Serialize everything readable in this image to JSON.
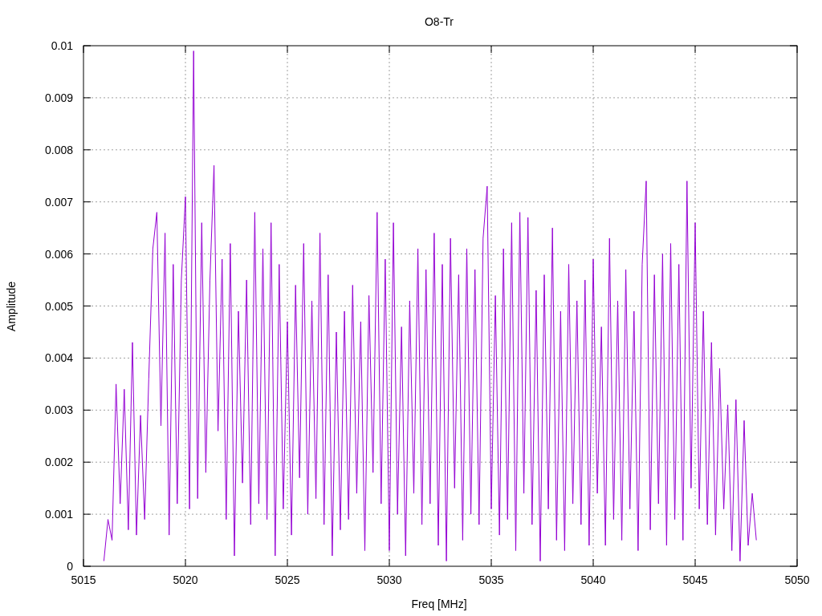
{
  "plot": {
    "chart_data": {
      "type": "line",
      "title": "O8-Tr",
      "xlabel": "Freq [MHz]",
      "ylabel": "Amplitude",
      "grid": true,
      "xlim": [
        5015,
        5050
      ],
      "ylim": [
        0,
        0.01
      ],
      "xticks": [
        5015,
        5020,
        5025,
        5030,
        5035,
        5040,
        5045,
        5050
      ],
      "yticks": [
        0.01,
        0.009,
        0.008,
        0.007,
        0.006,
        0.005,
        0.004,
        0.003,
        0.002,
        0.001,
        0
      ],
      "x": [
        5016,
        5016.2,
        5016.4,
        5016.6,
        5016.8,
        5017,
        5017.2,
        5017.4,
        5017.6,
        5017.8,
        5018,
        5018.2,
        5018.4,
        5018.6,
        5018.8,
        5019,
        5019.2,
        5019.4,
        5019.6,
        5019.8,
        5020,
        5020.2,
        5020.4,
        5020.6,
        5020.8,
        5021,
        5021.2,
        5021.4,
        5021.6,
        5021.8,
        5022,
        5022.2,
        5022.4,
        5022.6,
        5022.8,
        5023,
        5023.2,
        5023.4,
        5023.6,
        5023.8,
        5024,
        5024.2,
        5024.4,
        5024.6,
        5024.8,
        5025,
        5025.2,
        5025.4,
        5025.6,
        5025.8,
        5026,
        5026.2,
        5026.4,
        5026.6,
        5026.8,
        5027,
        5027.2,
        5027.4,
        5027.6,
        5027.8,
        5028,
        5028.2,
        5028.4,
        5028.6,
        5028.8,
        5029,
        5029.2,
        5029.4,
        5029.6,
        5029.8,
        5030,
        5030.2,
        5030.4,
        5030.6,
        5030.8,
        5031,
        5031.2,
        5031.4,
        5031.6,
        5031.8,
        5032,
        5032.2,
        5032.4,
        5032.6,
        5032.8,
        5033,
        5033.2,
        5033.4,
        5033.6,
        5033.8,
        5034,
        5034.2,
        5034.4,
        5034.6,
        5034.8,
        5035,
        5035.2,
        5035.4,
        5035.6,
        5035.8,
        5036,
        5036.2,
        5036.4,
        5036.6,
        5036.8,
        5037,
        5037.2,
        5037.4,
        5037.6,
        5037.8,
        5038,
        5038.2,
        5038.4,
        5038.6,
        5038.8,
        5039,
        5039.2,
        5039.4,
        5039.6,
        5039.8,
        5040,
        5040.2,
        5040.4,
        5040.6,
        5040.8,
        5041,
        5041.2,
        5041.4,
        5041.6,
        5041.8,
        5042,
        5042.2,
        5042.4,
        5042.6,
        5042.8,
        5043,
        5043.2,
        5043.4,
        5043.6,
        5043.8,
        5044,
        5044.2,
        5044.4,
        5044.6,
        5044.8,
        5045,
        5045.2,
        5045.4,
        5045.6,
        5045.8,
        5046,
        5046.2,
        5046.4,
        5046.6,
        5046.8,
        5047,
        5047.2,
        5047.4,
        5047.6,
        5047.8,
        5048
      ],
      "series": [
        {
          "color": "#9400d3",
          "values": [
            0.0001,
            0.0009,
            0.0005,
            0.0035,
            0.0012,
            0.0034,
            0.0007,
            0.0043,
            0.0006,
            0.0029,
            0.0009,
            0.0036,
            0.0061,
            0.0068,
            0.0027,
            0.0064,
            0.0006,
            0.0058,
            0.0012,
            0.0055,
            0.0071,
            0.0011,
            0.0099,
            0.0013,
            0.0066,
            0.0018,
            0.0055,
            0.0077,
            0.0026,
            0.0059,
            0.0009,
            0.0062,
            0.0002,
            0.0049,
            0.0016,
            0.0055,
            0.0008,
            0.0068,
            0.0012,
            0.0061,
            0.0009,
            0.0066,
            0.0002,
            0.0058,
            0.0011,
            0.0047,
            0.0006,
            0.0054,
            0.0017,
            0.0062,
            0.001,
            0.0051,
            0.0013,
            0.0064,
            0.0008,
            0.0056,
            0.0002,
            0.0045,
            0.0007,
            0.0049,
            0.0009,
            0.0054,
            0.0014,
            0.0047,
            0.0003,
            0.0052,
            0.0018,
            0.0068,
            0.0012,
            0.0059,
            0.0003,
            0.0066,
            0.001,
            0.0046,
            0.0002,
            0.0051,
            0.0014,
            0.0061,
            0.0008,
            0.0057,
            0.0012,
            0.0064,
            0.0004,
            0.0058,
            0.0001,
            0.0063,
            0.0015,
            0.0056,
            0.0005,
            0.0061,
            0.001,
            0.0057,
            0.0008,
            0.0063,
            0.0073,
            0.0011,
            0.0052,
            0.0006,
            0.0061,
            0.0009,
            0.0066,
            0.0003,
            0.0068,
            0.0014,
            0.0067,
            0.0008,
            0.0053,
            0.0001,
            0.0056,
            0.0011,
            0.0065,
            0.0005,
            0.0049,
            0.0003,
            0.0058,
            0.0012,
            0.0051,
            0.0008,
            0.0055,
            0.0004,
            0.0059,
            0.0014,
            0.0046,
            0.0004,
            0.0063,
            0.0009,
            0.0051,
            0.0005,
            0.0057,
            0.0011,
            0.0049,
            0.0003,
            0.0058,
            0.0074,
            0.0007,
            0.0056,
            0.0012,
            0.006,
            0.0004,
            0.0062,
            0.0009,
            0.0058,
            0.0005,
            0.0074,
            0.0015,
            0.0066,
            0.0011,
            0.0049,
            0.0008,
            0.0043,
            0.0006,
            0.0038,
            0.0011,
            0.0031,
            0.0003,
            0.0032,
            0.0001,
            0.0028,
            0.0004,
            0.0014,
            0.0005
          ]
        }
      ]
    }
  }
}
